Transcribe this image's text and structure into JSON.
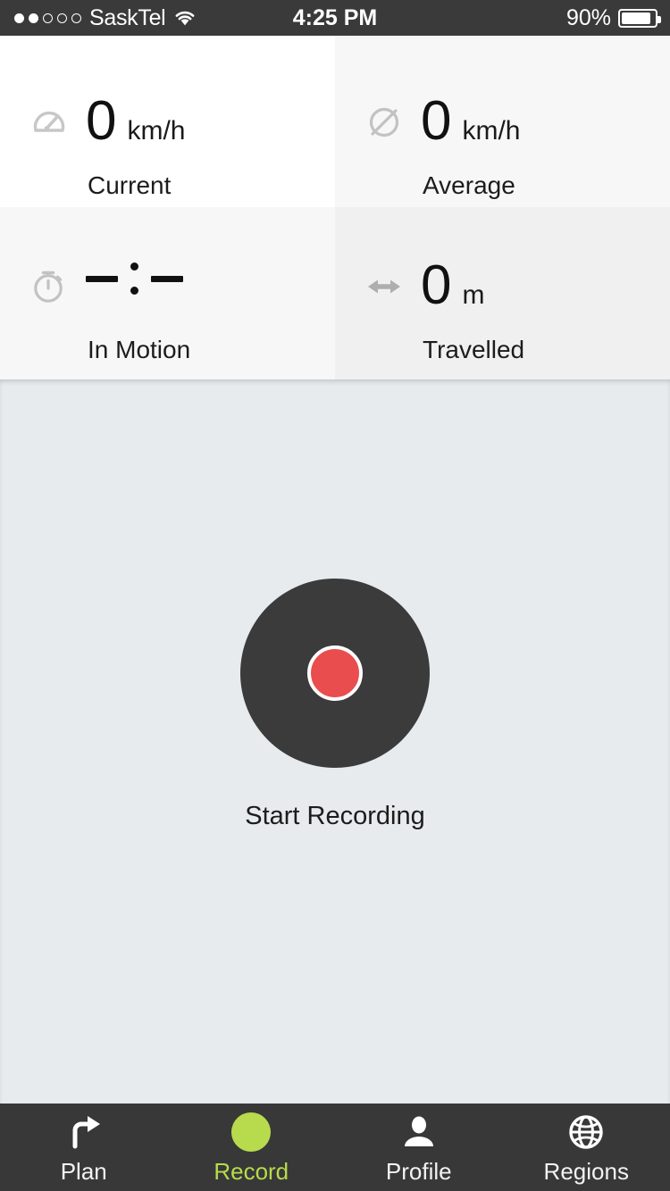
{
  "status_bar": {
    "carrier": "SaskTel",
    "signal_dots_total": 5,
    "signal_dots_filled": 2,
    "wifi_icon": "wifi-icon",
    "time": "4:25 PM",
    "battery_percent": "90%",
    "battery_level": 90,
    "bg_color": "#3a3a3a"
  },
  "stats": [
    {
      "icon": "speedometer-icon",
      "value": "0",
      "unit": "km/h",
      "label": "Current",
      "bg": "#ffffff"
    },
    {
      "icon": "average-diameter-icon",
      "value": "0",
      "unit": "km/h",
      "label": "Average",
      "bg": "#f7f7f7"
    },
    {
      "icon": "stopwatch-icon",
      "value": "—:—",
      "unit": "",
      "label": "In Motion",
      "bg": "#f7f7f7"
    },
    {
      "icon": "double-arrow-horizontal-icon",
      "value": "0",
      "unit": "m",
      "label": "Travelled",
      "bg": "#f0f0f0"
    }
  ],
  "record": {
    "button_label": "Start Recording",
    "button_color": "#3b3b3b",
    "inner_color": "#ea4d4d",
    "background": "#e7ebee"
  },
  "tabbar": {
    "bg_color": "#383838",
    "active_color": "#b7db4c",
    "items": [
      {
        "label": "Plan",
        "icon": "turn-right-arrow-icon",
        "active": false
      },
      {
        "label": "Record",
        "icon": "record-dot-icon",
        "active": true
      },
      {
        "label": "Profile",
        "icon": "person-icon",
        "active": false
      },
      {
        "label": "Regions",
        "icon": "globe-icon",
        "active": false
      }
    ]
  }
}
